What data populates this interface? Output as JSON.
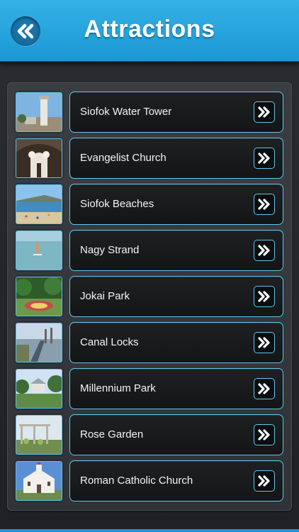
{
  "header": {
    "title": "Attractions",
    "back_icon": "double-chevron-left-icon",
    "accent": "#1b97d4"
  },
  "list": {
    "items": [
      {
        "label": "Siofok Water Tower",
        "thumb": "water-tower-photo"
      },
      {
        "label": "Evangelist Church",
        "thumb": "church-facade-photo"
      },
      {
        "label": "Siofok Beaches",
        "thumb": "beach-photo"
      },
      {
        "label": "Nagy Strand",
        "thumb": "lake-swimmer-photo"
      },
      {
        "label": "Jokai Park",
        "thumb": "park-garden-photo"
      },
      {
        "label": "Canal Locks",
        "thumb": "canal-photo"
      },
      {
        "label": "Millennium Park",
        "thumb": "millennium-park-photo"
      },
      {
        "label": "Rose Garden",
        "thumb": "rose-garden-photo"
      },
      {
        "label": "Roman Catholic Church",
        "thumb": "white-church-photo"
      }
    ],
    "row_icon": "double-chevron-right-icon"
  }
}
